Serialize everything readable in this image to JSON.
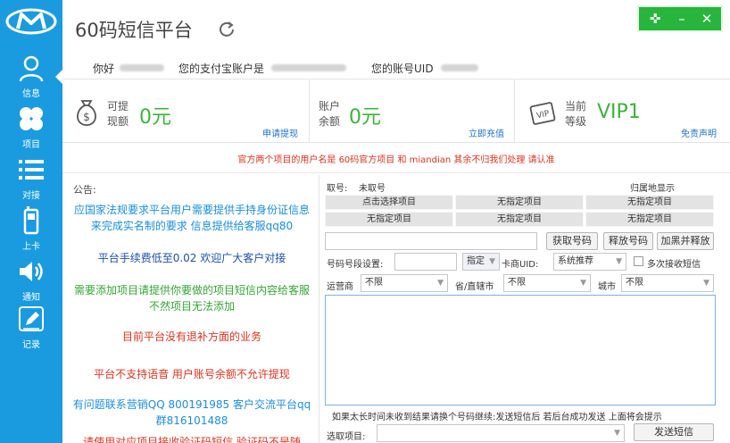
{
  "app": {
    "title": "60码短信平台"
  },
  "sidebar": {
    "items": [
      {
        "label": "信息",
        "icon": "user-icon"
      },
      {
        "label": "项目",
        "icon": "clover-icon"
      },
      {
        "label": "对接",
        "icon": "list-icon"
      },
      {
        "label": "上卡",
        "icon": "phone-icon"
      },
      {
        "label": "通知",
        "icon": "speaker-icon"
      },
      {
        "label": "记录",
        "icon": "pen-icon"
      }
    ]
  },
  "user": {
    "greeting": "你好",
    "alipay_label": "您的支付宝账户是",
    "uid_label": "您的账号UID"
  },
  "stats": {
    "withdrawable": {
      "label": "可提现额",
      "value": "0元",
      "link": "申请提现"
    },
    "balance": {
      "label": "账户余额",
      "value": "0元",
      "link": "立即充值"
    },
    "level": {
      "label": "当前等级",
      "value": "VIP1",
      "link": "免责声明"
    }
  },
  "notice": "官方两个项目的用户名是 60码官方项目 和 miandian 其余不归我们处理 请认准",
  "announcement": {
    "heading": "公告:",
    "paragraphs": [
      "应国家法规要求平台用户需要提供手持身份证信息来完成实名制的要求 信息提供给客服qq80",
      "平台手续费低至0.02 欢迎广大客户对接",
      "需要添加项目请提供你要做的项目短信内容给客服 不然项目无法添加",
      "目前平台没有退补方面的业务",
      "平台不支持语音 用户账号余额不允许提现",
      "有问题联系营销QQ 800191985 客户交流平台qq群816101488",
      "请使用对应项目接收验证码短信 验证码不是随"
    ]
  },
  "panel": {
    "number_label": "取号:",
    "number_status": "未取号",
    "location_hint": "归属地显示",
    "grid": [
      [
        "点击选择项目",
        "无指定项目",
        "无指定项目"
      ],
      [
        "无指定项目",
        "无指定项目",
        "无指定项目"
      ]
    ],
    "buttons": {
      "get_number": "获取号码",
      "release_number": "释放号码",
      "blacklist_release": "加黑并释放",
      "send_sms": "发送短信"
    },
    "segment_label": "号码号段设置:",
    "segment_mode": "指定",
    "merchant_label": "卡商UID:",
    "merchant_value": "系统推荐",
    "multi_receive_label": "多次接收短信",
    "carrier_label": "运营商",
    "carrier_value": "不限",
    "province_label": "省/直辖市",
    "province_value": "不限",
    "city_label": "城市",
    "city_value": "不限",
    "hint": "如果太长时间未收到结果请换个号码继续:发送短信后 若后台成功发送 上面将会提示",
    "select_project_label": "选取项目:"
  },
  "colors": {
    "sidebar": "#1a9be0",
    "accent_green": "#3cb43c",
    "notice_red": "#e0321e",
    "link_blue": "#1f73c9"
  }
}
